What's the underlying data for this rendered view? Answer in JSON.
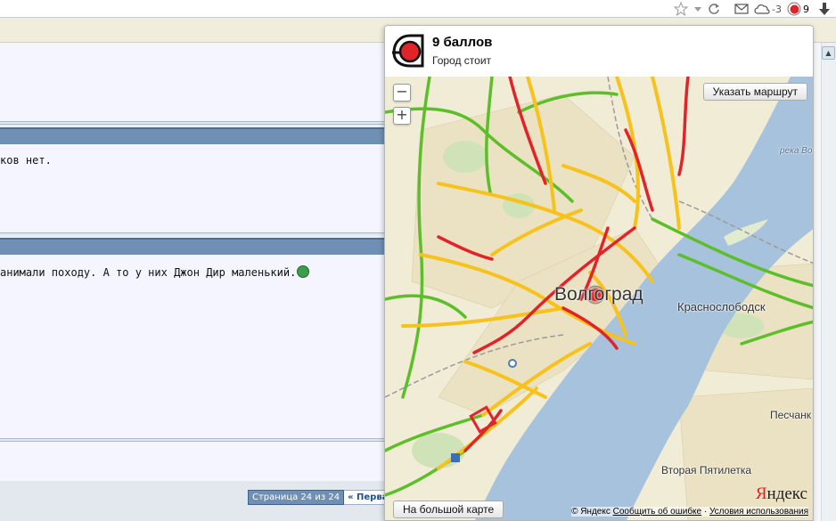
{
  "browser": {
    "cloud_temp": "-3",
    "ext_score": "9"
  },
  "forum": {
    "post1_text": "ков нет.",
    "post2_text": "анимали походу. А то у них Джон Дир маленький.",
    "pager_info": "Страница 24 из 24",
    "pager_first": "« Перва"
  },
  "popup": {
    "score_title": "9 баллов",
    "score_subtitle": "Город стоит",
    "route_button": "Указать маршрут",
    "zoom_out": "−",
    "zoom_in": "+",
    "big_map_button": "На большой карте",
    "copyright": "© Яндекс",
    "report_error": "Сообщить об ошибке",
    "separator": "·",
    "terms": "Условия использования",
    "logo_y": "Я",
    "logo_rest": "ндекс"
  },
  "map_labels": {
    "city": "Волгоград",
    "krasnoslobodsk": "Краснослободск",
    "river": "река Во",
    "peschanka": "Песчанк",
    "vtoraya": "Вторая Пятилетка"
  },
  "colors": {
    "jam_red": "#e0242a",
    "jam_yellow": "#f7c21b",
    "free_green": "#5cbf2a",
    "water": "#a7c2dd"
  }
}
